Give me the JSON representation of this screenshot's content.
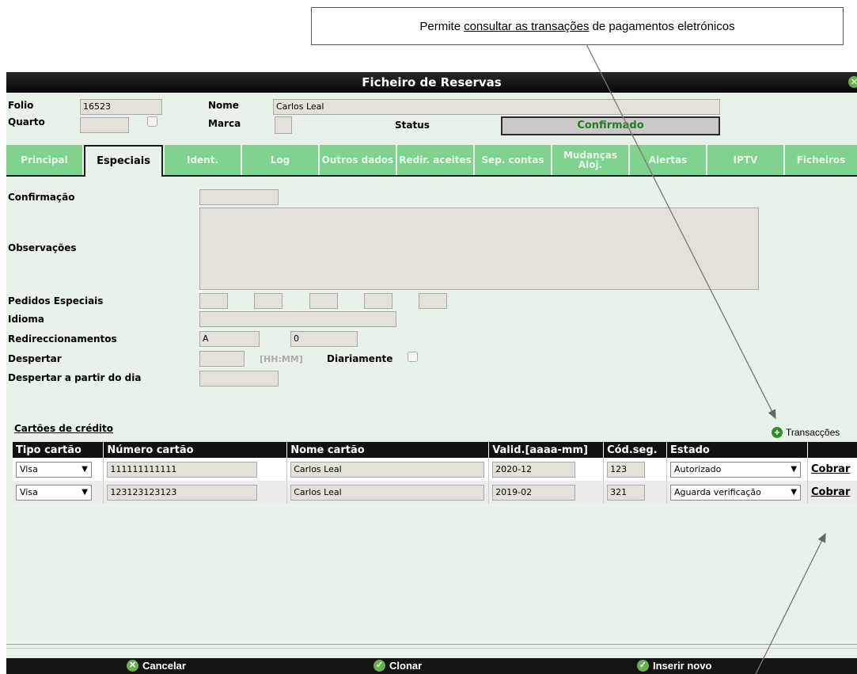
{
  "callout": {
    "prefix": "Permite",
    "underlined": "consultar as transações",
    "suffix": "de pagamentos eletrónicos"
  },
  "window": {
    "title": "Ficheiro de Reservas"
  },
  "header": {
    "folio_label": "Folio",
    "folio_value": "16523",
    "quarto_label": "Quarto",
    "quarto_value": "",
    "nome_label": "Nome",
    "nome_value": "Carlos Leal",
    "marca_label": "Marca",
    "status_label": "Status",
    "status_value": "Confirmado"
  },
  "tabs": [
    {
      "label": "Principal"
    },
    {
      "label": "Especiais"
    },
    {
      "label": "Ident."
    },
    {
      "label": "Log"
    },
    {
      "label": "Outros dados"
    },
    {
      "label": "Redir. aceites"
    },
    {
      "label": "Sep. contas"
    },
    {
      "label": "Mudanças Aloj."
    },
    {
      "label": "Alertas"
    },
    {
      "label": "IPTV"
    },
    {
      "label": "Ficheiros"
    }
  ],
  "active_tab": "Especiais",
  "form": {
    "confirmacao_label": "Confirmação",
    "observacoes_label": "Observações",
    "pedidos_label": "Pedidos Especiais",
    "idioma_label": "Idioma",
    "redirec_label": "Redireccionamentos",
    "redirec_value1": "A",
    "redirec_value2": "0",
    "despertar_label": "Despertar",
    "hhmm_hint": "[HH:MM]",
    "diariamente_label": "Diariamente",
    "despertar_dia_label": "Despertar a partir do dia"
  },
  "cards": {
    "section_title": "Cartões de crédito",
    "transacoes_label": "Transacções",
    "columns": [
      "Tipo cartão",
      "Número cartão",
      "Nome cartão",
      "Valid.[aaaa-mm]",
      "Cód.seg.",
      "Estado",
      ""
    ],
    "rows": [
      {
        "tipo": "Visa",
        "numero": "111111111111",
        "nome": "Carlos Leal",
        "valid": "2020-12",
        "cod": "123",
        "estado": "Autorizado",
        "action": "Cobrar"
      },
      {
        "tipo": "Visa",
        "numero": "123123123123",
        "nome": "Carlos Leal",
        "valid": "2019-02",
        "cod": "321",
        "estado": "Aguarda verificação",
        "action": "Cobrar"
      }
    ]
  },
  "footer": {
    "cancel": "Cancelar",
    "clone": "Clonar",
    "insert": "Inserir novo"
  },
  "colors": {
    "accent_green": "#7fd38e",
    "status_green": "#1e7d1e",
    "titlebar": "#111111"
  }
}
